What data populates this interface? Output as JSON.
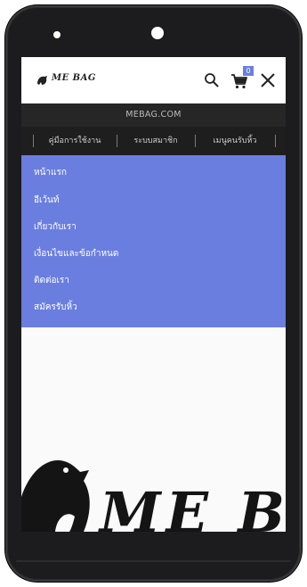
{
  "header": {
    "logo_text": "ME BAG",
    "cart_count": "0"
  },
  "site_bar": {
    "domain": "MEBAG.COM"
  },
  "sub_nav": {
    "items": [
      {
        "label": "คู่มือการใช้งาน"
      },
      {
        "label": "ระบบสมาชิก"
      },
      {
        "label": "เมนูคนรับหิ้ว"
      }
    ]
  },
  "menu": {
    "items": [
      {
        "label": "หน้าแรก"
      },
      {
        "label": "อีเว้นท์"
      },
      {
        "label": "เกี่ยวกับเรา"
      },
      {
        "label": "เงื่อนไขและข้อกำหนด"
      },
      {
        "label": "ติดต่อเรา"
      },
      {
        "label": "สมัครรับหิ้ว"
      }
    ]
  },
  "hero": {
    "logo_text": "ME BAG"
  },
  "colors": {
    "accent": "#6a7ee0",
    "dark_bar": "#262626",
    "sub_nav": "#1e1e1e",
    "phone_body": "#1c1c1e"
  },
  "icons": {
    "search": "search-icon",
    "cart": "cart-icon",
    "close": "close-icon",
    "logo": "bird-logo-icon"
  }
}
